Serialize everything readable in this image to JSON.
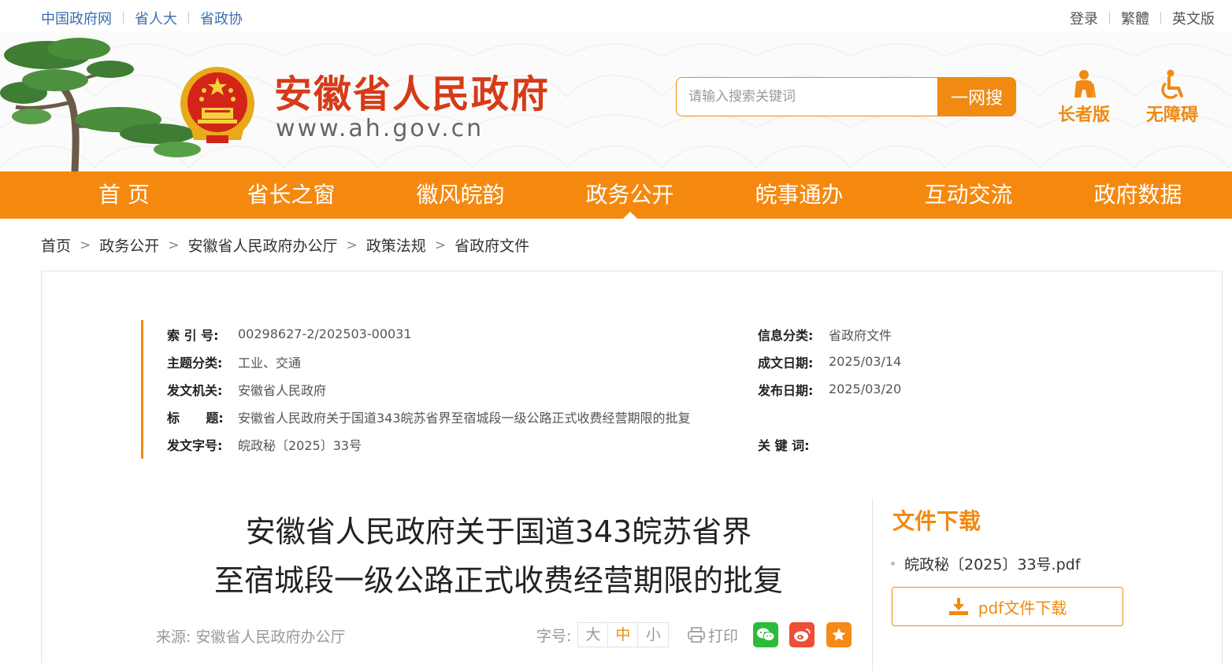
{
  "top_links_left": [
    "中国政府网",
    "省人大",
    "省政协"
  ],
  "top_links_right": [
    "登录",
    "繁體",
    "英文版"
  ],
  "site": {
    "title": "安徽省人民政府",
    "url": "www.ah.gov.cn"
  },
  "search": {
    "placeholder": "请输入搜索关键词",
    "button": "一网搜"
  },
  "modes": {
    "elder": "长者版",
    "accessible": "无障碍"
  },
  "nav": {
    "items": [
      "首 页",
      "省长之窗",
      "徽风皖韵",
      "政务公开",
      "皖事通办",
      "互动交流",
      "政府数据"
    ],
    "active": "政务公开"
  },
  "breadcrumb": [
    "首页",
    "政务公开",
    "安徽省人民政府办公厅",
    "政策法规",
    "省政府文件"
  ],
  "meta": {
    "index_no": {
      "label": "索 引 号:",
      "value": "00298627-2/202503-00031"
    },
    "subject": {
      "label": "主题分类:",
      "value": "工业、交通"
    },
    "issuer": {
      "label": "发文机关:",
      "value": "安徽省人民政府"
    },
    "title": {
      "label": "标      题:",
      "value": "安徽省人民政府关于国道343皖苏省界至宿城段一级公路正式收费经营期限的批复"
    },
    "doc_no": {
      "label": "发文字号:",
      "value": "皖政秘〔2025〕33号"
    },
    "info_class": {
      "label": "信息分类:",
      "value": "省政府文件"
    },
    "created_date": {
      "label": "成文日期:",
      "value": "2025/03/14"
    },
    "publish_date": {
      "label": "发布日期:",
      "value": "2025/03/20"
    },
    "keywords": {
      "label": "关 键 词:",
      "value": ""
    }
  },
  "document": {
    "title_line1": "安徽省人民政府关于国道343皖苏省界",
    "title_line2": "至宿城段一级公路正式收费经营期限的批复",
    "source_label": "来源:",
    "source_value": "安徽省人民政府办公厅"
  },
  "font_size": {
    "label": "字号:",
    "options": [
      "大",
      "中",
      "小"
    ],
    "selected": "中"
  },
  "print_label": "打印",
  "share_icons": [
    "wechat-icon",
    "weibo-icon",
    "favorite-icon"
  ],
  "download": {
    "title": "文件下载",
    "file_name": "皖政秘〔2025〕33号.pdf",
    "button": "pdf文件下载"
  },
  "colors": {
    "accent": "#f08a12",
    "nav_bg": "#f5890f",
    "title_red": "#d63b18",
    "link_blue": "#3a6fb0"
  }
}
